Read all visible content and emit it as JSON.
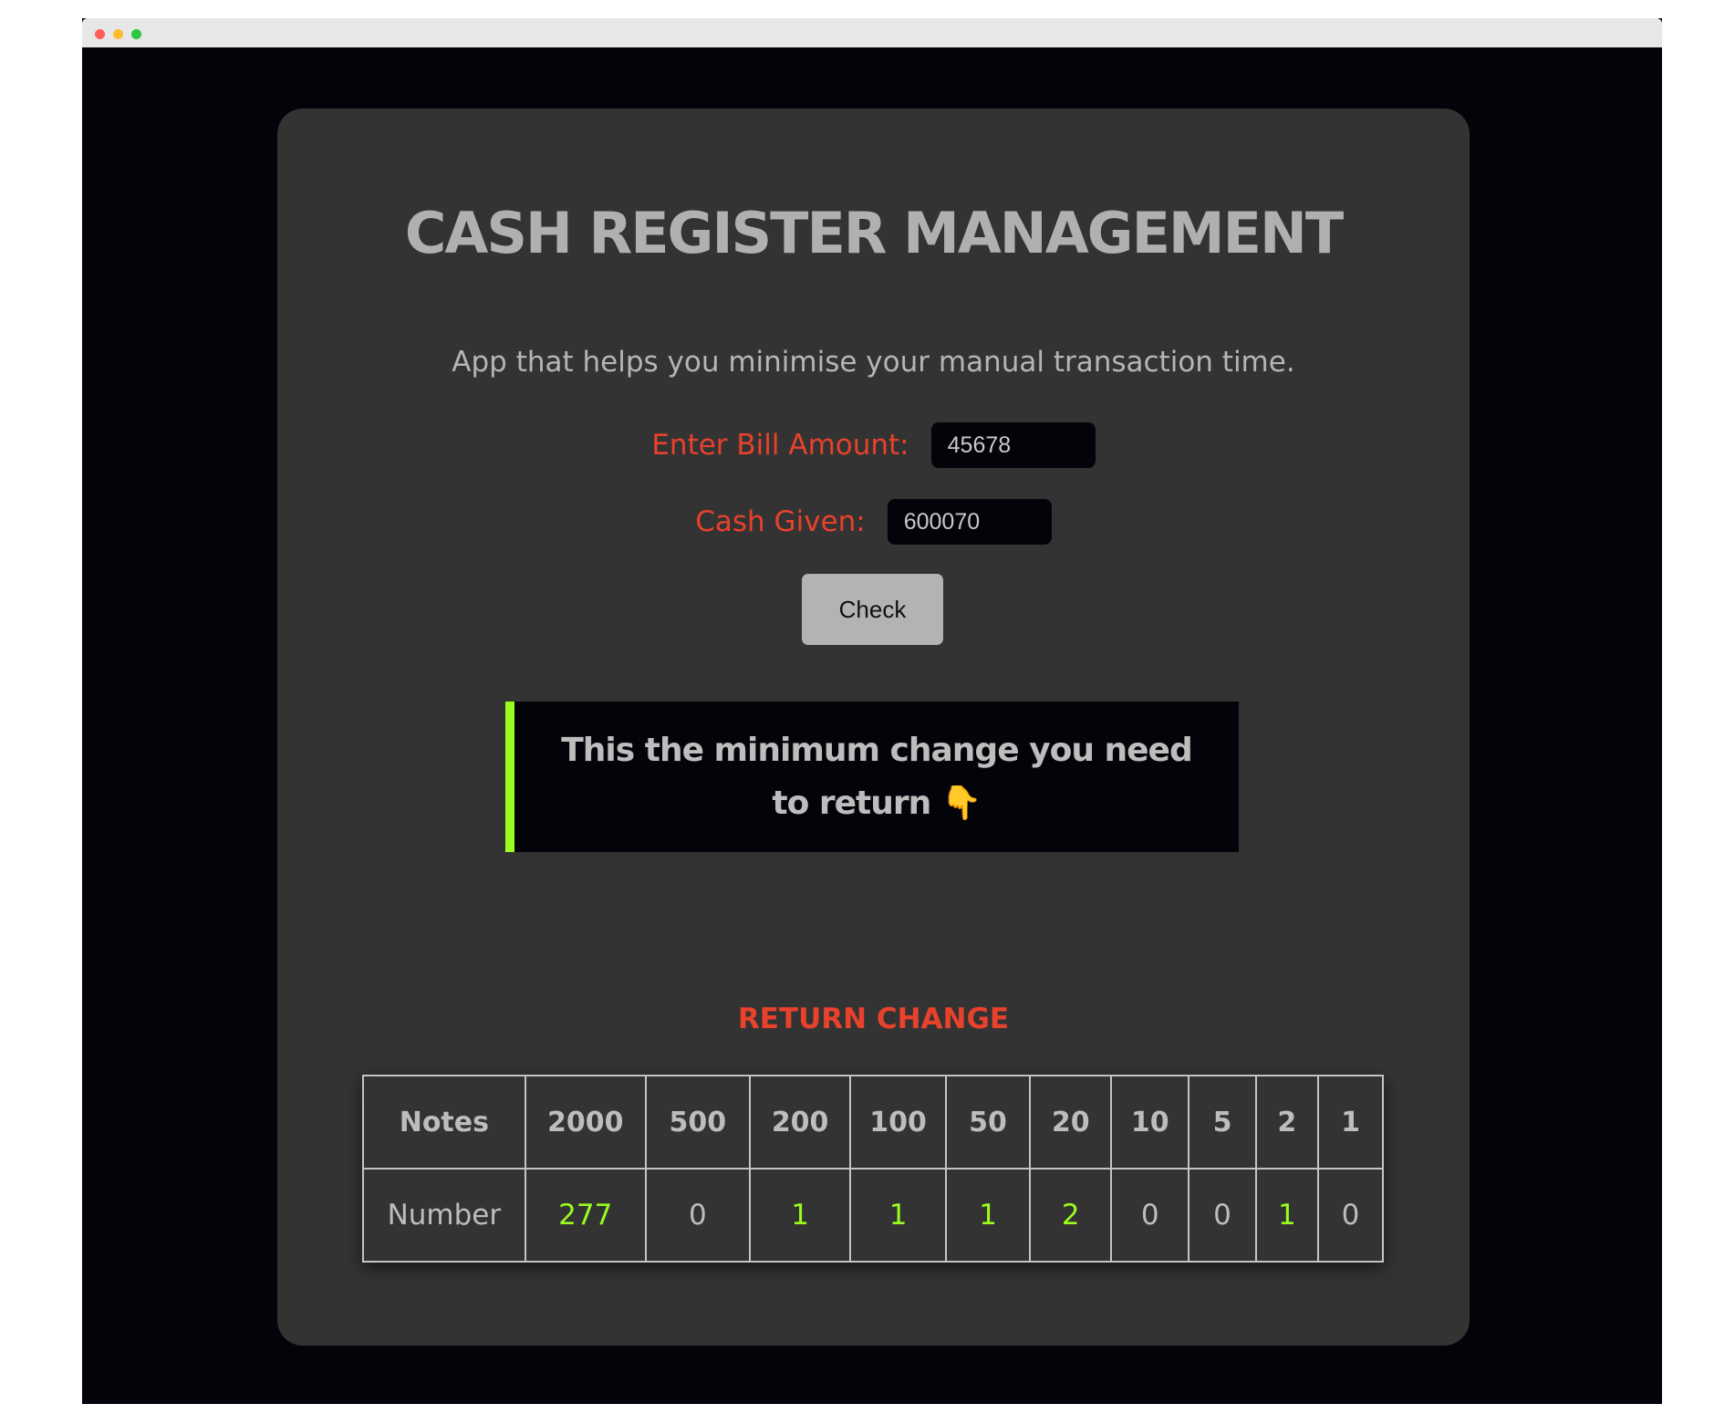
{
  "app": {
    "title": "CASH REGISTER MANAGEMENT",
    "description": "App that helps you minimise your manual transaction time."
  },
  "form": {
    "bill_label": "Enter Bill Amount:",
    "bill_value": "45678",
    "cash_label": "Cash Given:",
    "cash_value": "600070",
    "check_label": "Check"
  },
  "message": {
    "text": "This the minimum change you need to return 👇"
  },
  "return_change": {
    "heading": "RETURN CHANGE",
    "row_header_notes": "Notes",
    "row_header_number": "Number",
    "notes": [
      "2000",
      "500",
      "200",
      "100",
      "50",
      "20",
      "10",
      "5",
      "2",
      "1"
    ],
    "counts": [
      "277",
      "0",
      "1",
      "1",
      "1",
      "2",
      "0",
      "0",
      "1",
      "0"
    ]
  },
  "colors": {
    "page_background": "#020409",
    "card_background": "#333333",
    "accent_red": "#e8412c",
    "accent_green": "#9afc1f",
    "text_gray": "#b0b0b0",
    "button_gray": "#b3b3b3"
  }
}
